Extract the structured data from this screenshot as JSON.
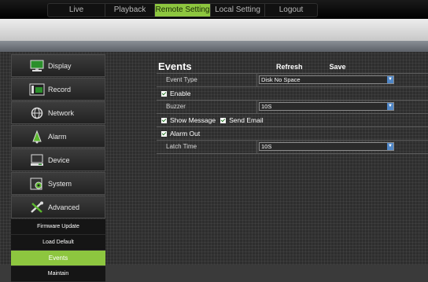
{
  "topnav": {
    "tabs": [
      {
        "label": "Live",
        "active": false
      },
      {
        "label": "Playback",
        "active": false
      },
      {
        "label": "Remote Setting",
        "active": true
      },
      {
        "label": "Local Setting",
        "active": false
      },
      {
        "label": "Logout",
        "active": false
      }
    ]
  },
  "sidebar": {
    "items": [
      {
        "label": "Display",
        "icon": "monitor-icon"
      },
      {
        "label": "Record",
        "icon": "film-icon"
      },
      {
        "label": "Network",
        "icon": "globe-icon"
      },
      {
        "label": "Alarm",
        "icon": "alarm-icon"
      },
      {
        "label": "Device",
        "icon": "device-icon"
      },
      {
        "label": "System",
        "icon": "system-gear-icon"
      },
      {
        "label": "Advanced",
        "icon": "tools-icon"
      }
    ],
    "subitems": [
      {
        "label": "Firmware Update",
        "active": false
      },
      {
        "label": "Load Default",
        "active": false
      },
      {
        "label": "Events",
        "active": true
      },
      {
        "label": "Maintain",
        "active": false
      }
    ]
  },
  "panel": {
    "title": "Events",
    "refresh_label": "Refresh",
    "save_label": "Save",
    "event_type_label": "Event Type",
    "event_type_value": "Disk No Space",
    "enable_label": "Enable",
    "buzzer_label": "Buzzer",
    "buzzer_value": "10S",
    "show_message_label": "Show Message",
    "send_email_label": "Send Email",
    "alarm_out_label": "Alarm Out",
    "latch_time_label": "Latch Time",
    "latch_time_value": "10S"
  },
  "colors": {
    "accent": "#8dc63f",
    "select_button": "#4f86c6"
  }
}
